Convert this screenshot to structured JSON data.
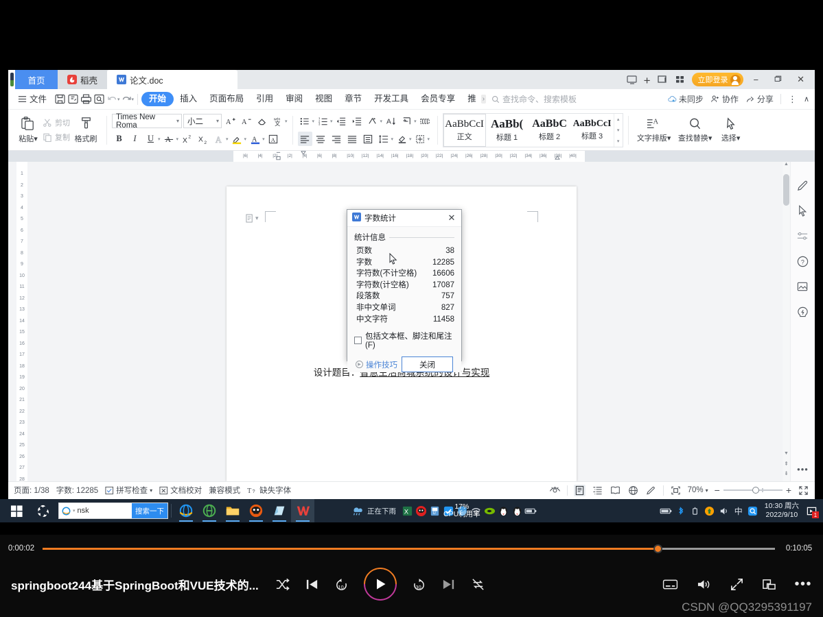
{
  "window": {
    "tabs": [
      {
        "label": "首页",
        "icon": "home-tab"
      },
      {
        "label": "稻壳",
        "icon": "daoke-icon"
      },
      {
        "label": "论文.doc",
        "icon": "wps-doc-icon"
      }
    ],
    "new_tab_label": "+",
    "login_label": "立即登录",
    "minimize": "−",
    "maximize": "❐",
    "close": "✕"
  },
  "menubar": {
    "file_label": "文件",
    "tabs": [
      "开始",
      "插入",
      "页面布局",
      "引用",
      "审阅",
      "视图",
      "章节",
      "开发工具",
      "会员专享",
      "推"
    ],
    "active_tab": "开始",
    "more_chevron": "›",
    "search_placeholder": "查找命令、搜索模板",
    "right_items": [
      {
        "label": "未同步",
        "icon": "cloud-sync-icon"
      },
      {
        "label": "协作",
        "icon": "collaborate-icon"
      },
      {
        "label": "分享",
        "icon": "share-icon"
      }
    ],
    "overflow_label": "⋮",
    "collapse_label": "∧"
  },
  "ribbon": {
    "paste_label": "粘贴",
    "cut_label": "剪切",
    "copy_label": "复制",
    "format_painter_label": "格式刷",
    "font_name": "Times New Roma",
    "font_size": "小二",
    "styles": [
      {
        "preview": "AaBbCcI",
        "name": "正文",
        "selected": true
      },
      {
        "preview": "AaBb(",
        "name": "标题 1",
        "selected": false
      },
      {
        "preview": "AaBbC",
        "name": "标题 2",
        "selected": false
      },
      {
        "preview": "AaBbCcI",
        "name": "标题 3",
        "selected": false
      }
    ],
    "typeset_label": "文字排版",
    "find_replace_label": "查找替换",
    "select_label": "选择"
  },
  "ruler": {
    "ticks": [
      "6",
      "4",
      "2",
      "2",
      "4",
      "6",
      "8",
      "10",
      "12",
      "14",
      "16",
      "18",
      "20",
      "22",
      "24",
      "26",
      "28",
      "30",
      "32",
      "34",
      "36",
      "38",
      "40"
    ]
  },
  "vruler": {
    "ticks": [
      "1",
      "2",
      "3",
      "4",
      "5",
      "6",
      "7",
      "8",
      "9",
      "10",
      "11",
      "12",
      "13",
      "14",
      "15",
      "16",
      "17",
      "18",
      "19",
      "20",
      "21",
      "22",
      "23",
      "24",
      "25",
      "26",
      "27",
      "28"
    ]
  },
  "document": {
    "title_prefix": "设计题目：",
    "title_underlined": "智慧生活商城系统的设计与实现"
  },
  "statusbar": {
    "page_label": "页面: 1/38",
    "word_count_label": "字数: 12285",
    "spellcheck_label": "拼写检查",
    "proofread_label": "文档校对",
    "compat_label": "兼容模式",
    "missing_font_label": "缺失字体",
    "zoom_label": "70%",
    "zoom_minus": "−",
    "zoom_plus": "+"
  },
  "dialog": {
    "title": "字数统计",
    "icon": "wps-word-icon",
    "close_icon": "✕",
    "legend": "统计信息",
    "rows": [
      {
        "label": "页数",
        "value": "38"
      },
      {
        "label": "字数",
        "value": "12285"
      },
      {
        "label": "字符数(不计空格)",
        "value": "16606"
      },
      {
        "label": "字符数(计空格)",
        "value": "17087"
      },
      {
        "label": "段落数",
        "value": "757"
      },
      {
        "label": "非中文单词",
        "value": "827"
      },
      {
        "label": "中文字符",
        "value": "11458"
      }
    ],
    "checkbox_label": "包括文本框、脚注和尾注(F)",
    "checkbox_checked": false,
    "tip_label": "操作技巧",
    "close_button": "关闭"
  },
  "taskbar": {
    "start_icon": "windows-start-icon",
    "search_value": "nsk",
    "search_button": "搜索一下",
    "apps": [
      {
        "name": "internet-explorer-icon"
      },
      {
        "name": "360-browser-icon"
      },
      {
        "name": "file-explorer-icon"
      },
      {
        "name": "thunder-icon"
      },
      {
        "name": "sticky-notes-icon"
      },
      {
        "name": "wps-office-icon"
      }
    ],
    "weather_text": "正在下雨",
    "cpu_text": "17%",
    "cpu_label": "CPU利用率",
    "clock_time": "10:30 周六",
    "clock_date": "2022/9/10",
    "ime_label": "中",
    "notif_count": "1"
  },
  "player": {
    "current_time": "0:00:02",
    "total_time": "0:10:05",
    "progress_percent": 84,
    "video_title": "springboot244基于SpringBoot和VUE技术的...",
    "buttons": {
      "shuffle": "shuffle-icon",
      "previous": "previous-icon",
      "rewind10": "rewind-10-icon",
      "play": "play-icon",
      "forward30": "forward-30-icon",
      "next": "next-icon",
      "no-repeat": "no-repeat-icon",
      "subtitles": "subtitles-icon",
      "volume": "volume-icon",
      "fullscreen": "fullscreen-icon",
      "pip": "picture-in-picture-icon",
      "more": "more-options-icon"
    }
  },
  "watermark": "CSDN @QQ3295391197"
}
